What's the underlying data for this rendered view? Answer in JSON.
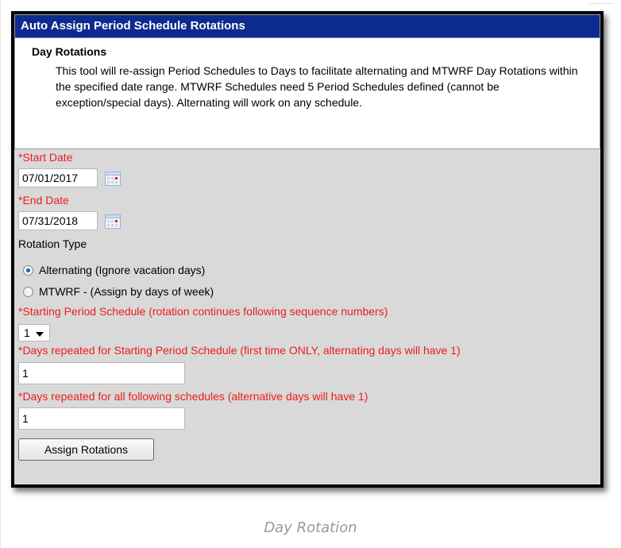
{
  "panel": {
    "header": "Auto Assign Period Schedule Rotations",
    "section_title": "Day Rotations",
    "description": "This tool will re-assign Period Schedules to Days to facilitate alternating and MTWRF Day Rotations within the specified date range. MTWRF Schedules need 5 Period Schedules defined (cannot be exception/special days). Alternating will work on any schedule."
  },
  "form": {
    "start_date_label": "*Start Date",
    "start_date_value": "07/01/2017",
    "end_date_label": "*End Date",
    "end_date_value": "07/31/2018",
    "rotation_type_label": "Rotation Type",
    "rotation_options": [
      {
        "label": "Alternating (Ignore vacation days)",
        "selected": true
      },
      {
        "label": "MTWRF - (Assign by days of week)",
        "selected": false
      }
    ],
    "starting_schedule_label": "*Starting Period Schedule (rotation continues following sequence numbers)",
    "starting_schedule_value": "1",
    "days_repeated_start_label": "*Days repeated for Starting Period Schedule (first time ONLY, alternating days will have 1)",
    "days_repeated_start_value": "1",
    "days_repeated_following_label": "*Days repeated for all following schedules (alternative days will have 1)",
    "days_repeated_following_value": "1",
    "assign_button": "Assign Rotations"
  },
  "caption": "Day Rotation",
  "colors": {
    "header_bg": "#0d2b8e",
    "required_label": "#ee1b1b",
    "form_bg": "#d9d9d9",
    "frame": "#000000"
  },
  "icons": {
    "calendar": "calendar-icon",
    "dropdown": "chevron-down-icon"
  }
}
